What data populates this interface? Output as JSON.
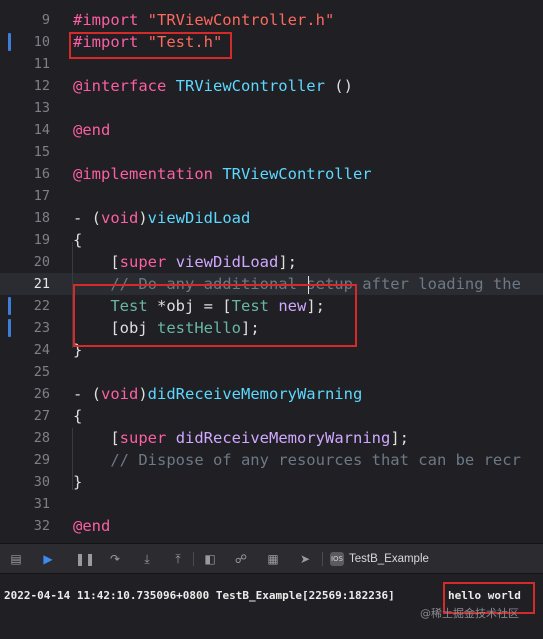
{
  "editor": {
    "lines": [
      {
        "num": "9",
        "segs": [
          {
            "t": "#import ",
            "c": "kw"
          },
          {
            "t": "\"TRViewController.h\"",
            "c": "str"
          }
        ]
      },
      {
        "num": "10",
        "segs": [
          {
            "t": "#import ",
            "c": "kw"
          },
          {
            "t": "\"Test.h\"",
            "c": "str"
          }
        ]
      },
      {
        "num": "11",
        "segs": []
      },
      {
        "num": "12",
        "segs": [
          {
            "t": "@interface ",
            "c": "kw"
          },
          {
            "t": "TRViewController",
            "c": "type"
          },
          {
            "t": " ()",
            "c": ""
          }
        ]
      },
      {
        "num": "13",
        "segs": []
      },
      {
        "num": "14",
        "segs": [
          {
            "t": "@end",
            "c": "kw"
          }
        ]
      },
      {
        "num": "15",
        "segs": []
      },
      {
        "num": "16",
        "segs": [
          {
            "t": "@implementation ",
            "c": "kw"
          },
          {
            "t": "TRViewController",
            "c": "type"
          }
        ]
      },
      {
        "num": "17",
        "segs": []
      },
      {
        "num": "18",
        "segs": [
          {
            "t": "- (",
            "c": ""
          },
          {
            "t": "void",
            "c": "kw"
          },
          {
            "t": ")",
            "c": ""
          },
          {
            "t": "viewDidLoad",
            "c": "type"
          }
        ]
      },
      {
        "num": "19",
        "segs": [
          {
            "t": "{",
            "c": ""
          }
        ]
      },
      {
        "num": "20",
        "segs": [
          {
            "t": "    [",
            "c": ""
          },
          {
            "t": "super",
            "c": "kw"
          },
          {
            "t": " ",
            "c": ""
          },
          {
            "t": "viewDidLoad",
            "c": "cls"
          },
          {
            "t": "];",
            "c": ""
          }
        ]
      },
      {
        "num": "21",
        "segs": [
          {
            "t": "    // Do any additional setup after loading the",
            "c": "comment"
          }
        ]
      },
      {
        "num": "22",
        "segs": [
          {
            "t": "    ",
            "c": ""
          },
          {
            "t": "Test",
            "c": "meth"
          },
          {
            "t": " *obj = [",
            "c": ""
          },
          {
            "t": "Test",
            "c": "meth"
          },
          {
            "t": " ",
            "c": ""
          },
          {
            "t": "new",
            "c": "cls"
          },
          {
            "t": "];",
            "c": ""
          }
        ]
      },
      {
        "num": "23",
        "segs": [
          {
            "t": "    [obj ",
            "c": ""
          },
          {
            "t": "testHello",
            "c": "meth"
          },
          {
            "t": "];",
            "c": ""
          }
        ]
      },
      {
        "num": "24",
        "segs": [
          {
            "t": "}",
            "c": ""
          }
        ]
      },
      {
        "num": "25",
        "segs": []
      },
      {
        "num": "26",
        "segs": [
          {
            "t": "- (",
            "c": ""
          },
          {
            "t": "void",
            "c": "kw"
          },
          {
            "t": ")",
            "c": ""
          },
          {
            "t": "didReceiveMemoryWarning",
            "c": "type"
          }
        ]
      },
      {
        "num": "27",
        "segs": [
          {
            "t": "{",
            "c": ""
          }
        ]
      },
      {
        "num": "28",
        "segs": [
          {
            "t": "    [",
            "c": ""
          },
          {
            "t": "super",
            "c": "kw"
          },
          {
            "t": " ",
            "c": ""
          },
          {
            "t": "didReceiveMemoryWarning",
            "c": "cls"
          },
          {
            "t": "];",
            "c": ""
          }
        ]
      },
      {
        "num": "29",
        "segs": [
          {
            "t": "    // Dispose of any resources that can be recr",
            "c": "comment"
          }
        ]
      },
      {
        "num": "30",
        "segs": [
          {
            "t": "}",
            "c": ""
          }
        ]
      },
      {
        "num": "31",
        "segs": []
      },
      {
        "num": "32",
        "segs": [
          {
            "t": "@end",
            "c": "kw"
          }
        ]
      }
    ]
  },
  "debug_bar": {
    "icons": [
      "console-toggle-icon",
      "breakpoint-icon",
      "pause-icon",
      "step-over-icon",
      "step-into-icon",
      "step-out-icon",
      "view-hierarchy-icon",
      "memory-graph-icon",
      "environment-icon",
      "location-icon"
    ],
    "target_icon_label": "IOS",
    "target": "TestB_Example"
  },
  "console": {
    "log_prefix": "2022-04-14 11:42:10.735096+0800 TestB_Example[22569:182236]",
    "output": "hello world"
  },
  "watermark": "@稀土掘金技术社区",
  "colors": {
    "background": "#1f1f24",
    "keyword": "#fc5fa3",
    "string": "#fc6a5d",
    "type": "#5dd8ff",
    "method": "#67b7a4",
    "class_method": "#d0a8ff",
    "comment": "#6c7986",
    "highlight_box": "#d42a2a",
    "change_marker": "#3d7fd8"
  }
}
